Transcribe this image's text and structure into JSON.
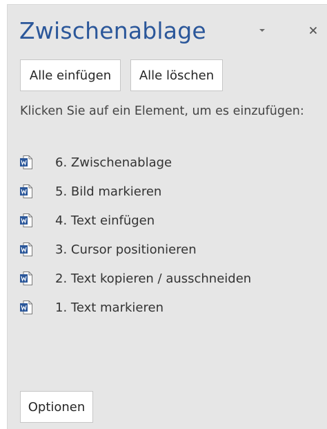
{
  "pane": {
    "title": "Zwischenablage",
    "buttons": {
      "paste_all": "Alle einfügen",
      "clear_all": "Alle löschen",
      "options": "Optionen"
    },
    "instruction": "Klicken Sie auf ein Element, um es einzufügen:",
    "items": [
      {
        "label": "6. Zwischenablage",
        "icon": "word-document-icon"
      },
      {
        "label": "5. Bild markieren",
        "icon": "word-document-icon"
      },
      {
        "label": "4. Text einfügen",
        "icon": "word-document-icon"
      },
      {
        "label": "3. Cursor positionieren",
        "icon": "word-document-icon"
      },
      {
        "label": "2. Text kopieren / ausschneiden",
        "icon": "word-document-icon"
      },
      {
        "label": "1. Text markieren",
        "icon": "word-document-icon"
      }
    ]
  },
  "colors": {
    "title": "#2b579a",
    "pane_background": "#e6e6e6",
    "word_icon": "#2b579a"
  },
  "icons": {
    "dropdown": "chevron-down-icon",
    "close": "close-icon"
  }
}
